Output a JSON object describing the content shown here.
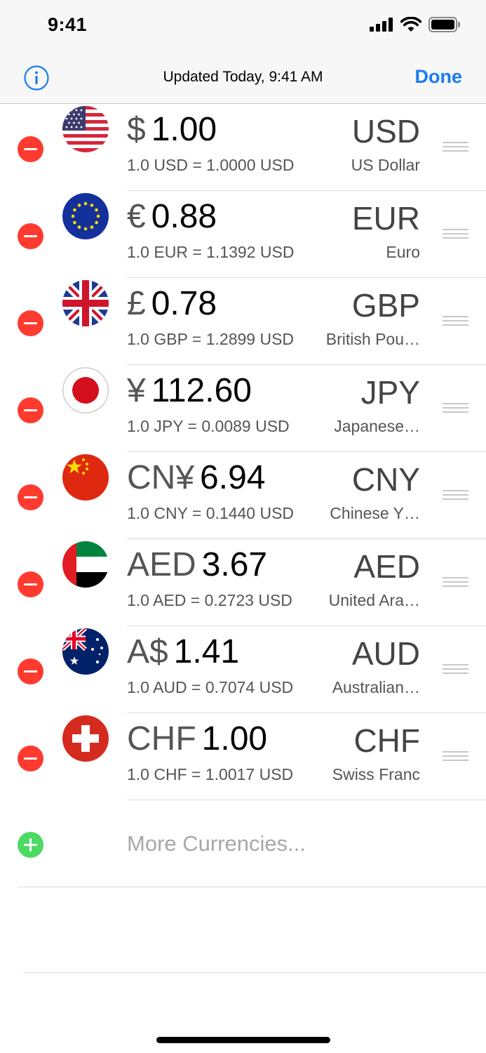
{
  "status": {
    "time": "9:41"
  },
  "nav": {
    "title": "Updated Today, 9:41 AM",
    "done_label": "Done",
    "info_icon": "info-icon"
  },
  "currencies": [
    {
      "flag": "us",
      "symbol": "$",
      "amount": "1.00",
      "rate": "1.0 USD = 1.0000 USD",
      "code": "USD",
      "name": "US Dollar"
    },
    {
      "flag": "eu",
      "symbol": "€",
      "amount": "0.88",
      "rate": "1.0 EUR = 1.1392 USD",
      "code": "EUR",
      "name": "Euro"
    },
    {
      "flag": "gb",
      "symbol": "£",
      "amount": "0.78",
      "rate": "1.0 GBP = 1.2899 USD",
      "code": "GBP",
      "name": "British Pou…"
    },
    {
      "flag": "jp",
      "symbol": "¥",
      "amount": "112.60",
      "rate": "1.0 JPY = 0.0089 USD",
      "code": "JPY",
      "name": "Japanese…"
    },
    {
      "flag": "cn",
      "symbol": "CN¥",
      "amount": "6.94",
      "rate": "1.0 CNY = 0.1440 USD",
      "code": "CNY",
      "name": "Chinese Y…"
    },
    {
      "flag": "ae",
      "symbol": "AED",
      "amount": "3.67",
      "rate": "1.0 AED = 0.2723 USD",
      "code": "AED",
      "name": "United Ara…"
    },
    {
      "flag": "au",
      "symbol": "A$",
      "amount": "1.41",
      "rate": "1.0 AUD = 0.7074 USD",
      "code": "AUD",
      "name": "Australian…"
    },
    {
      "flag": "ch",
      "symbol": "CHF",
      "amount": "1.00",
      "rate": "1.0 CHF = 1.0017 USD",
      "code": "CHF",
      "name": "Swiss Franc"
    }
  ],
  "more": {
    "label": "More Currencies..."
  },
  "colors": {
    "accent": "#1a7cf0",
    "delete": "#ff3b30",
    "add": "#4cd964"
  }
}
